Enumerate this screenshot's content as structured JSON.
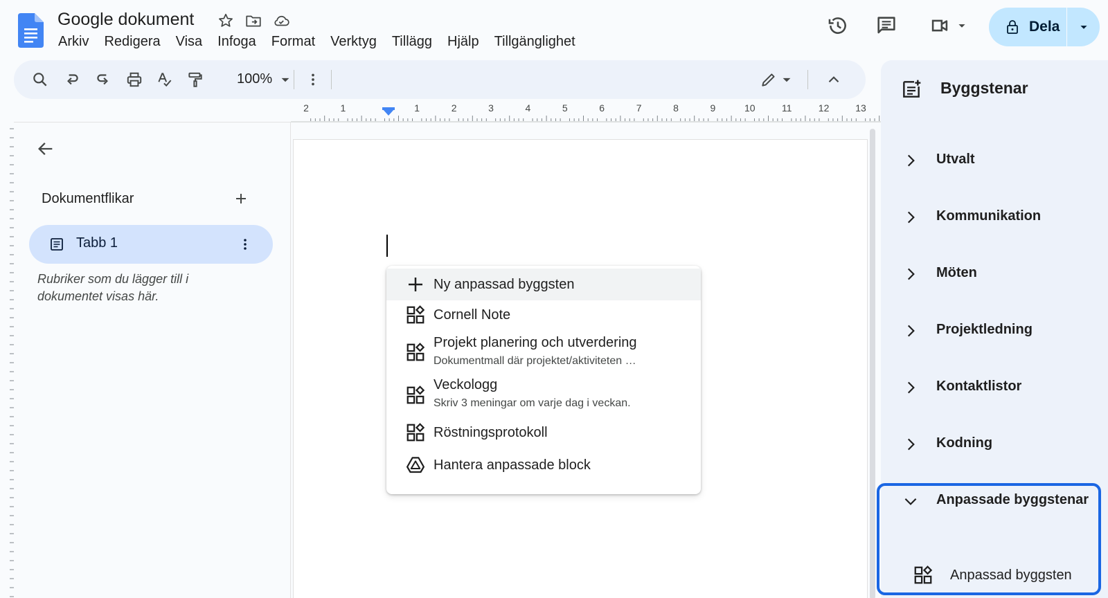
{
  "header": {
    "title": "Google dokument",
    "menu": [
      "Arkiv",
      "Redigera",
      "Visa",
      "Infoga",
      "Format",
      "Verktyg",
      "Tillägg",
      "Hjälp",
      "Tillgänglighet"
    ],
    "share_label": "Dela"
  },
  "toolbar": {
    "zoom": "100%"
  },
  "ruler": {
    "labels": [
      "2",
      "1",
      "",
      "1",
      "2",
      "3",
      "4",
      "5",
      "6",
      "7",
      "8",
      "9",
      "10",
      "11",
      "12",
      "13"
    ]
  },
  "left_panel": {
    "heading": "Dokumentflikar",
    "tab_label": "Tabb 1",
    "hint_line1": "Rubriker som du lägger till i",
    "hint_line2": "dokumentet visas här."
  },
  "popup": {
    "items": [
      {
        "title": "Ny anpassad byggsten",
        "subtitle": "",
        "icon": "plus-icon"
      },
      {
        "title": "Cornell Note",
        "subtitle": "",
        "icon": "building-block-icon"
      },
      {
        "title": "Projekt planering och utverdering",
        "subtitle": "Dokumentmall där projektet/aktiviteten …",
        "icon": "building-block-icon"
      },
      {
        "title": "Veckologg",
        "subtitle": "Skriv 3 meningar om varje dag i veckan.",
        "icon": "building-block-icon"
      },
      {
        "title": "Röstningsprotokoll",
        "subtitle": "",
        "icon": "building-block-icon"
      },
      {
        "title": "Hantera anpassade block",
        "subtitle": "",
        "icon": "drive-icon"
      }
    ]
  },
  "right_panel": {
    "title": "Byggstenar",
    "categories": [
      "Utvalt",
      "Kommunikation",
      "Möten",
      "Projektledning",
      "Kontaktlistor",
      "Kodning"
    ],
    "expanded_category": "Anpassade byggstenar",
    "custom_item": "Anpassad byggsten"
  },
  "colors": {
    "accent": "#1a66e3",
    "share_bg": "#c2e7ff",
    "active_tab_bg": "#d3e3fd",
    "toolbar_bg": "#edf2fa"
  }
}
